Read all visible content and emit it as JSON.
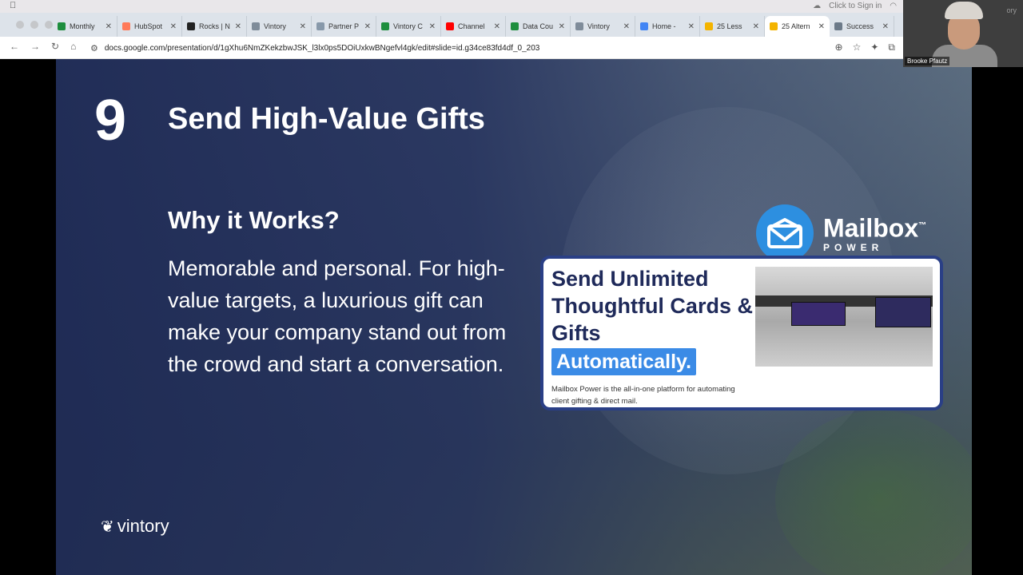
{
  "browser": {
    "menu_bar": {
      "apple": "",
      "right_text": "Click to Sign in"
    },
    "tabs": [
      {
        "title": "Monthly",
        "favicon_color": "#1e8e3e"
      },
      {
        "title": "HubSpot",
        "favicon_color": "#ff7a59"
      },
      {
        "title": "Rocks | N",
        "favicon_color": "#222222"
      },
      {
        "title": "Vintory",
        "favicon_color": "#7f8c9a"
      },
      {
        "title": "Partner P",
        "favicon_color": "#8899aa"
      },
      {
        "title": "Vintory C",
        "favicon_color": "#1e8e3e"
      },
      {
        "title": "Channel",
        "favicon_color": "#ff0000"
      },
      {
        "title": "Data Cou",
        "favicon_color": "#1e8e3e"
      },
      {
        "title": "Vintory",
        "favicon_color": "#7f8c9a"
      },
      {
        "title": "Home - ",
        "favicon_color": "#4285f4"
      },
      {
        "title": "25 Less",
        "favicon_color": "#f4b400"
      },
      {
        "title": "25 Altern",
        "favicon_color": "#f4b400",
        "active": true
      },
      {
        "title": "Success",
        "favicon_color": "#6c7a89"
      }
    ],
    "url": "docs.google.com/presentation/d/1gXhu6NmZKekzbwJSK_l3lx0ps5DOiUxkwBNgefvl4gk/edit#slide=id.g34ce83fd4df_0_203"
  },
  "slide": {
    "number": "9",
    "title": "Send High-Value Gifts",
    "subheading": "Why it Works?",
    "body": "Memorable and personal. For high-value targets, a luxurious gift can make your company stand out from the crowd and start a conversation.",
    "footer_logo": "vintory"
  },
  "mailbox_power": {
    "logo_name": "Mailbox",
    "logo_tm": "™",
    "logo_sub": "POWER",
    "card_heading": "Send Unlimited Thoughtful Cards & Gifts",
    "card_highlight": "Automatically.",
    "card_text": "Mailbox Power is the all-in-one platform for automating client gifting & direct mail."
  },
  "video": {
    "name": "Brooke Pfautz",
    "logo": "ory"
  }
}
